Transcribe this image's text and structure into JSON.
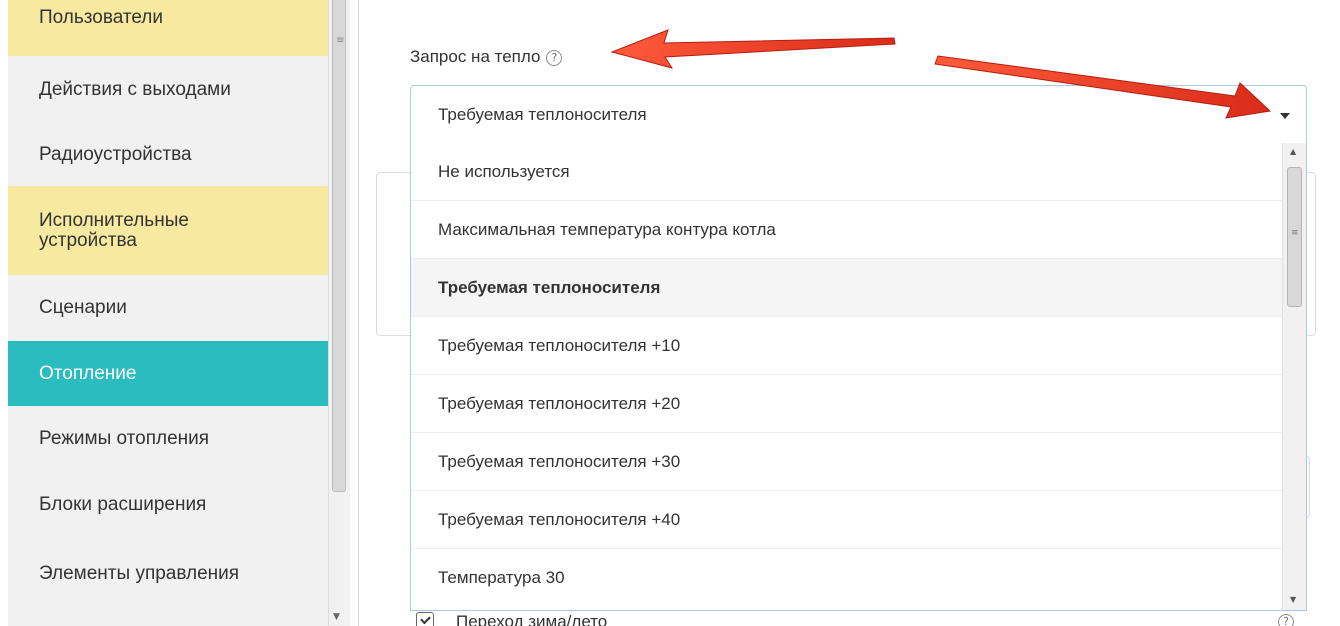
{
  "sidebar": {
    "items": [
      {
        "label": "Пользователи"
      },
      {
        "label": "Действия с выходами"
      },
      {
        "label": "Радиоустройства"
      },
      {
        "label": "Исполнительные устройства"
      },
      {
        "label": "Сценарии"
      },
      {
        "label": "Отопление"
      },
      {
        "label": "Режимы отопления"
      },
      {
        "label": "Блоки расширения"
      },
      {
        "label": "Элементы управления"
      }
    ],
    "active": "Отопление"
  },
  "heat_request": {
    "label": "Запрос на тепло",
    "help_symbol": "?",
    "selected_value": "Требуемая теплоносителя",
    "options": [
      "Не используется",
      "Максимальная температура контура котла",
      "Требуемая теплоносителя",
      "Требуемая теплоносителя +10",
      "Требуемая теплоносителя +20",
      "Требуемая теплоносителя +30",
      "Требуемая теплоносителя +40",
      "Температура 30"
    ]
  },
  "season_switch": {
    "label": "Переход зима/лето",
    "checked": true
  },
  "colors": {
    "active_item": "#2bbcbf",
    "highlight_item": "#f7e9a0",
    "sidebar_bg": "#f1f1f1",
    "select_border": "#a9c9e6",
    "arrow": "#e0321f"
  },
  "icons": [
    "help-icon",
    "caret-down-icon",
    "checkbox-icon"
  ]
}
